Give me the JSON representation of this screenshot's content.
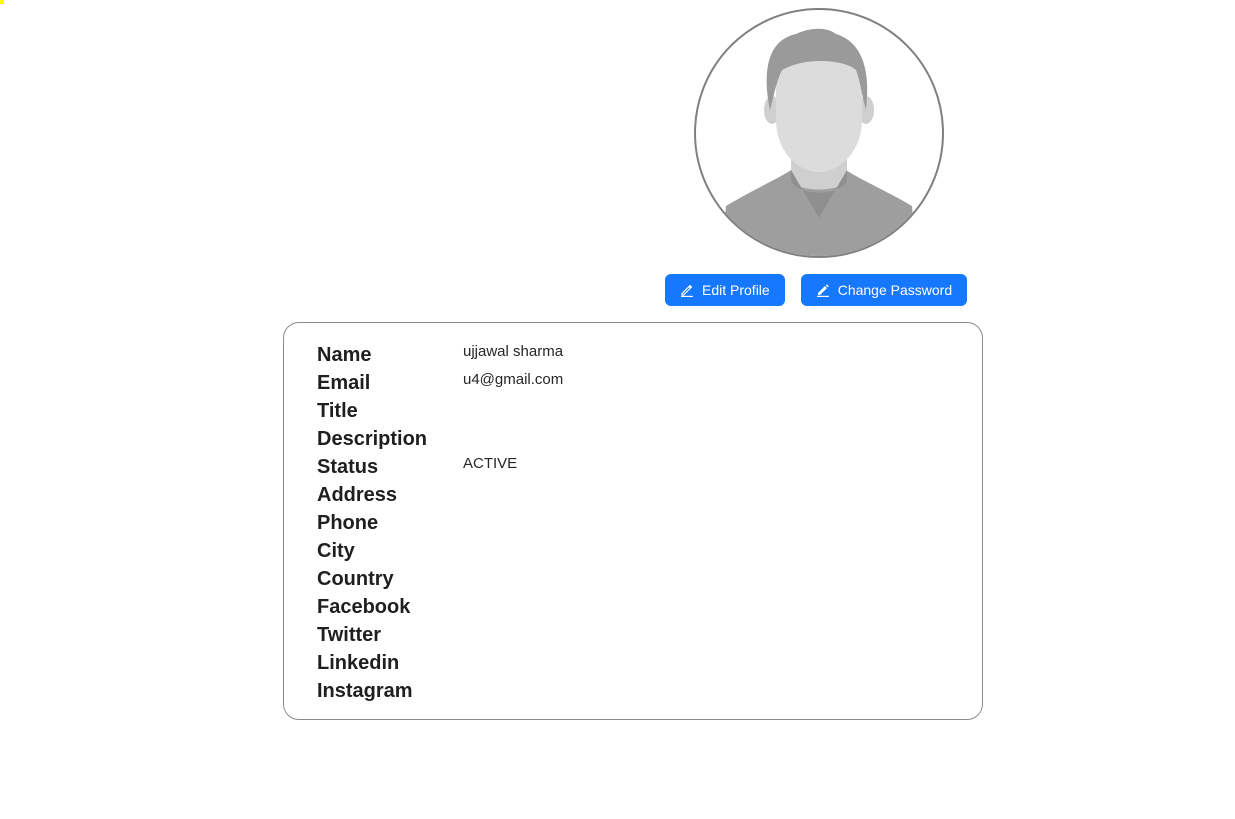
{
  "profile": {
    "avatar": {
      "icon": "default-user-avatar-icon",
      "border_color": "#808080"
    },
    "actions": {
      "edit_label": "Edit Profile",
      "edit_icon": "edit-icon",
      "change_password_label": "Change Password",
      "change_password_icon": "edit-filled-icon",
      "button_color": "#1677ff"
    },
    "fields": [
      {
        "label": "Name",
        "value": "ujjawal sharma"
      },
      {
        "label": "Email",
        "value": "u4@gmail.com"
      },
      {
        "label": "Title",
        "value": ""
      },
      {
        "label": "Description",
        "value": ""
      },
      {
        "label": "Status",
        "value": "ACTIVE"
      },
      {
        "label": "Address",
        "value": ""
      },
      {
        "label": "Phone",
        "value": ""
      },
      {
        "label": "City",
        "value": ""
      },
      {
        "label": "Country",
        "value": ""
      },
      {
        "label": "Facebook",
        "value": ""
      },
      {
        "label": "Twitter",
        "value": ""
      },
      {
        "label": "Linkedin",
        "value": ""
      },
      {
        "label": "Instagram",
        "value": ""
      }
    ]
  }
}
